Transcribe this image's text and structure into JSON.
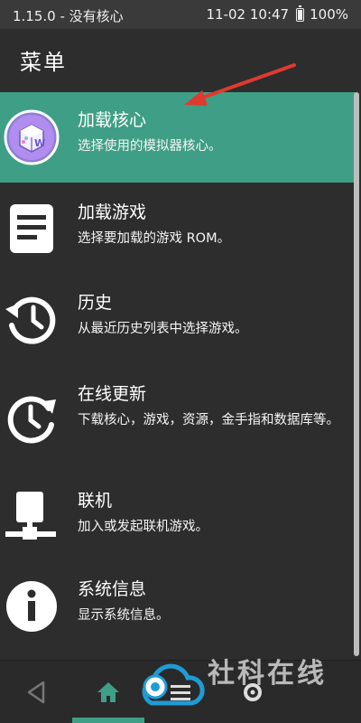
{
  "status_bar": {
    "left_text": "1.15.0 - 没有核心",
    "time": "11-02 10:47",
    "battery": "100%"
  },
  "header": {
    "title": "菜单"
  },
  "menu": {
    "items": [
      {
        "title": "加载核心",
        "description": "选择使用的模拟器核心。",
        "icon": "core-app-icon",
        "active": true
      },
      {
        "title": "加载游戏",
        "description": "选择要加载的游戏 ROM。",
        "icon": "document-icon"
      },
      {
        "title": "历史",
        "description": "从最近历史列表中选择游戏。",
        "icon": "history-icon"
      },
      {
        "title": "在线更新",
        "description": "下载核心，游戏，资源，金手指和数据库等。",
        "icon": "update-clock-icon"
      },
      {
        "title": "联机",
        "description": "加入或发起联机游戏。",
        "icon": "network-icon"
      },
      {
        "title": "系统信息",
        "description": "显示系统信息。",
        "icon": "info-icon"
      }
    ]
  },
  "bottom_nav": {
    "items": [
      "back-icon",
      "home-icon",
      "list-icon",
      "settings-icon"
    ]
  },
  "watermark": {
    "text": "社科在线"
  },
  "colors": {
    "accent": "#3f9f86",
    "background": "#2d2d2d",
    "arrow": "#e03a2f"
  }
}
